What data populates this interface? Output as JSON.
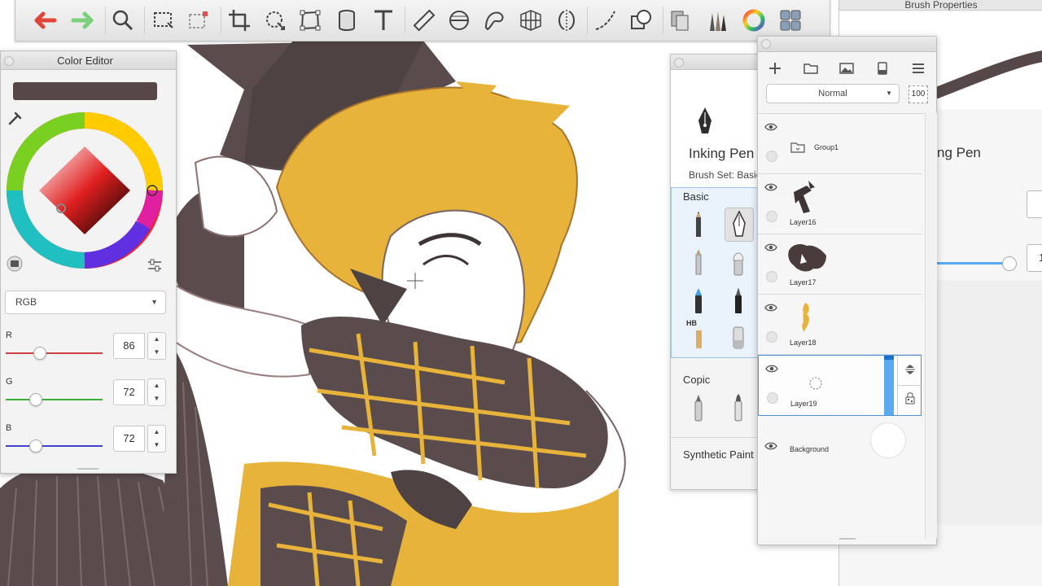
{
  "canvas": {
    "ink_color": "#564848",
    "hair_color": "#e8b33a",
    "cursor": "crosshair-icon"
  },
  "toolbar": {
    "tools": [
      "undo-icon",
      "redo-icon",
      "zoom-icon",
      "rect-select-icon",
      "lasso-select-icon",
      "crop-icon",
      "transform-icon",
      "distort-icon",
      "fill-icon",
      "text-icon",
      "ruler-icon",
      "ellipse-guide-icon",
      "french-curve-icon",
      "perspective-icon",
      "symmetry-icon",
      "stroke-guide-icon",
      "shape-icon",
      "copic-icon",
      "brush-library-icon",
      "color-wheel-icon",
      "layers-icon"
    ]
  },
  "brush_properties": {
    "title": "Brush Properties",
    "brush_name_partial": "ng Pen",
    "value_partial": "1"
  },
  "color_editor": {
    "title": "Color Editor",
    "current_color": "#564848",
    "mode": "RGB",
    "channels": [
      {
        "label": "R",
        "value": "86",
        "color": "#d04040"
      },
      {
        "label": "G",
        "value": "72",
        "color": "#38b038"
      },
      {
        "label": "B",
        "value": "72",
        "color": "#4040d0"
      }
    ]
  },
  "brush_library": {
    "brush_name": "Inking Pen",
    "brush_set": "Brush Set: Basic",
    "categories": [
      "Basic",
      "Copic",
      "Synthetic Paint"
    ],
    "hb_label": "HB"
  },
  "layer_editor": {
    "blend_mode": "Normal",
    "opacity": "100",
    "layers": [
      {
        "name": "Group1",
        "type": "group"
      },
      {
        "name": "Layer16",
        "type": "layer"
      },
      {
        "name": "Layer17",
        "type": "layer"
      },
      {
        "name": "Layer18",
        "type": "layer"
      },
      {
        "name": "Layer19",
        "type": "layer",
        "selected": true
      },
      {
        "name": "Background",
        "type": "background"
      }
    ]
  }
}
